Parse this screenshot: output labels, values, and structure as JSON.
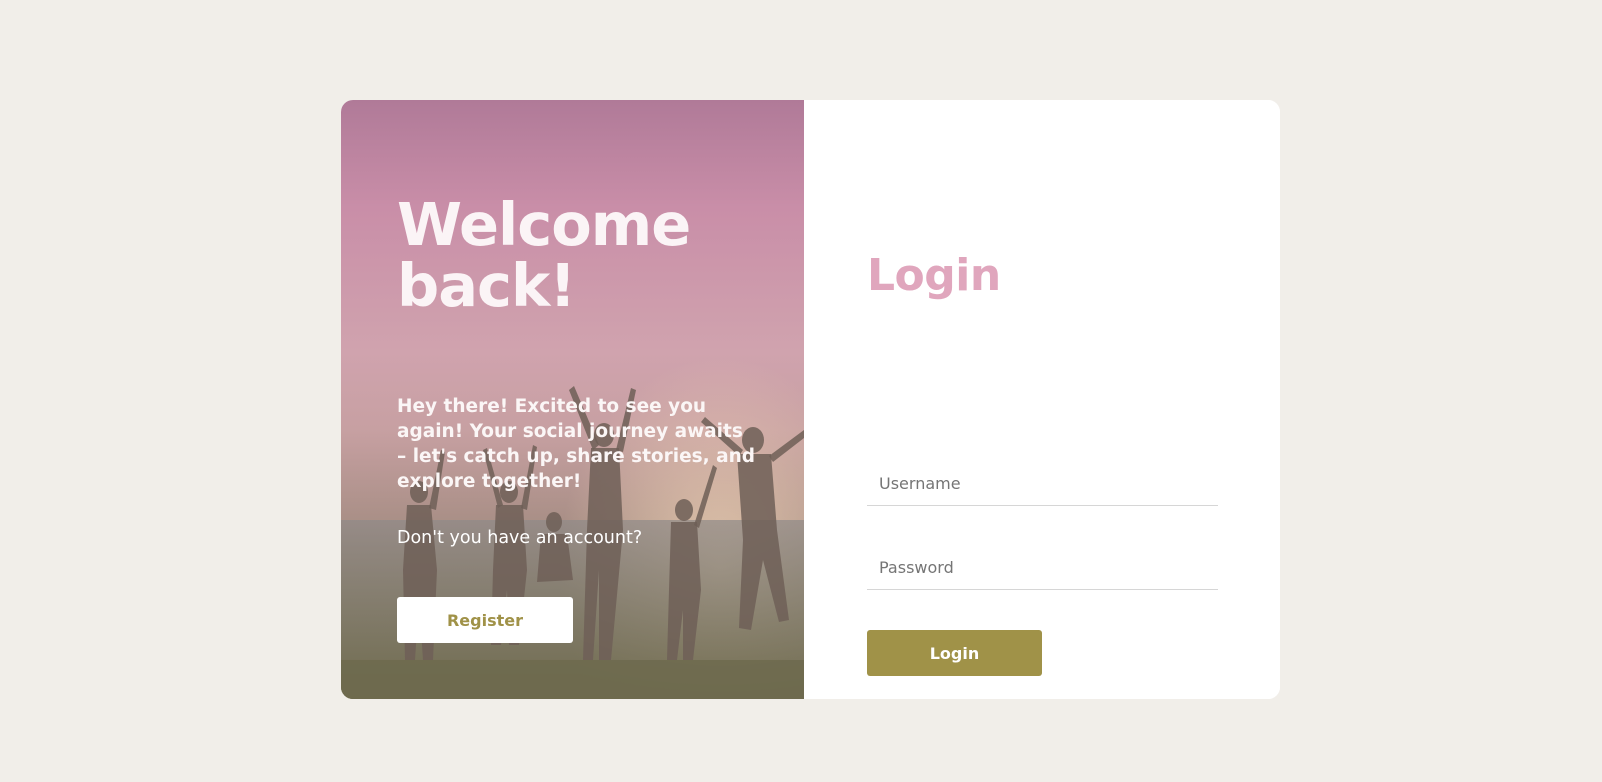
{
  "hero": {
    "title": "Welcome back!",
    "description": "Hey there! Excited to see you again! Your social journey awaits – let's catch up, share stories, and explore together!",
    "question": "Don't you have an account?",
    "register_label": "Register"
  },
  "login": {
    "title": "Login",
    "username_placeholder": "Username",
    "password_placeholder": "Password",
    "submit_label": "Login"
  },
  "colors": {
    "background": "#f1eee9",
    "accent_olive": "#a09248",
    "accent_pink": "#e0a6bd"
  }
}
